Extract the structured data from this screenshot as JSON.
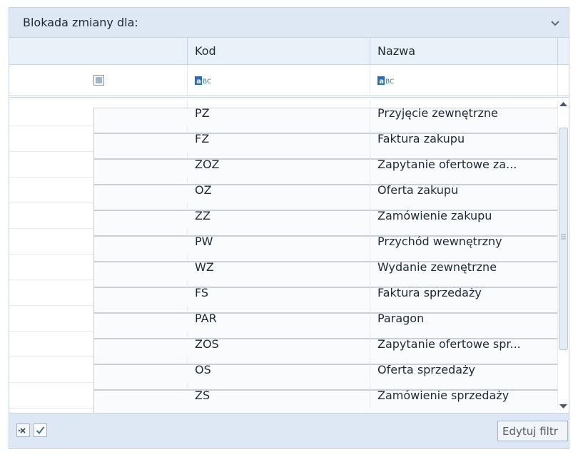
{
  "panel": {
    "title": "Blokada zmiany dla:",
    "collapse_icon": "chevron-down-icon"
  },
  "grid": {
    "columns": [
      {
        "key": "select",
        "label": ""
      },
      {
        "key": "kod",
        "label": "Kod"
      },
      {
        "key": "nazwa",
        "label": "Nazwa"
      }
    ],
    "filter_row": {
      "select_all_state": "indeterminate",
      "kod_filter_icon": "abc-text-filter-icon",
      "nazwa_filter_icon": "abc-text-filter-icon"
    },
    "rows": [
      {
        "checked": false,
        "kod": "PZ",
        "nazwa": "Przyjęcie zewnętrzne"
      },
      {
        "checked": false,
        "kod": "FZ",
        "nazwa": "Faktura zakupu"
      },
      {
        "checked": false,
        "kod": "ZOZ",
        "nazwa": "Zapytanie ofertowe za..."
      },
      {
        "checked": false,
        "kod": "OZ",
        "nazwa": "Oferta zakupu"
      },
      {
        "checked": false,
        "kod": "ZZ",
        "nazwa": "Zamówienie zakupu"
      },
      {
        "checked": false,
        "kod": "PW",
        "nazwa": "Przychód wewnętrzny"
      },
      {
        "checked": false,
        "kod": "WZ",
        "nazwa": "Wydanie zewnętrzne"
      },
      {
        "checked": false,
        "kod": "FS",
        "nazwa": "Faktura sprzedaży"
      },
      {
        "checked": false,
        "kod": "PAR",
        "nazwa": "Paragon"
      },
      {
        "checked": false,
        "kod": "ZOS",
        "nazwa": "Zapytanie ofertowe spr..."
      },
      {
        "checked": false,
        "kod": "OS",
        "nazwa": "Oferta sprzedaży"
      },
      {
        "checked": false,
        "kod": "ZS",
        "nazwa": "Zamówienie sprzedaży"
      }
    ]
  },
  "footer": {
    "clear_filter_icon": "clear-filter-icon",
    "filter_enabled_checkbox": true,
    "edit_filter_label": "Edytuj filtr"
  },
  "colors": {
    "header_bg": "#dde8f4",
    "border": "#c5d3e2",
    "accent": "#1f6fd1"
  }
}
